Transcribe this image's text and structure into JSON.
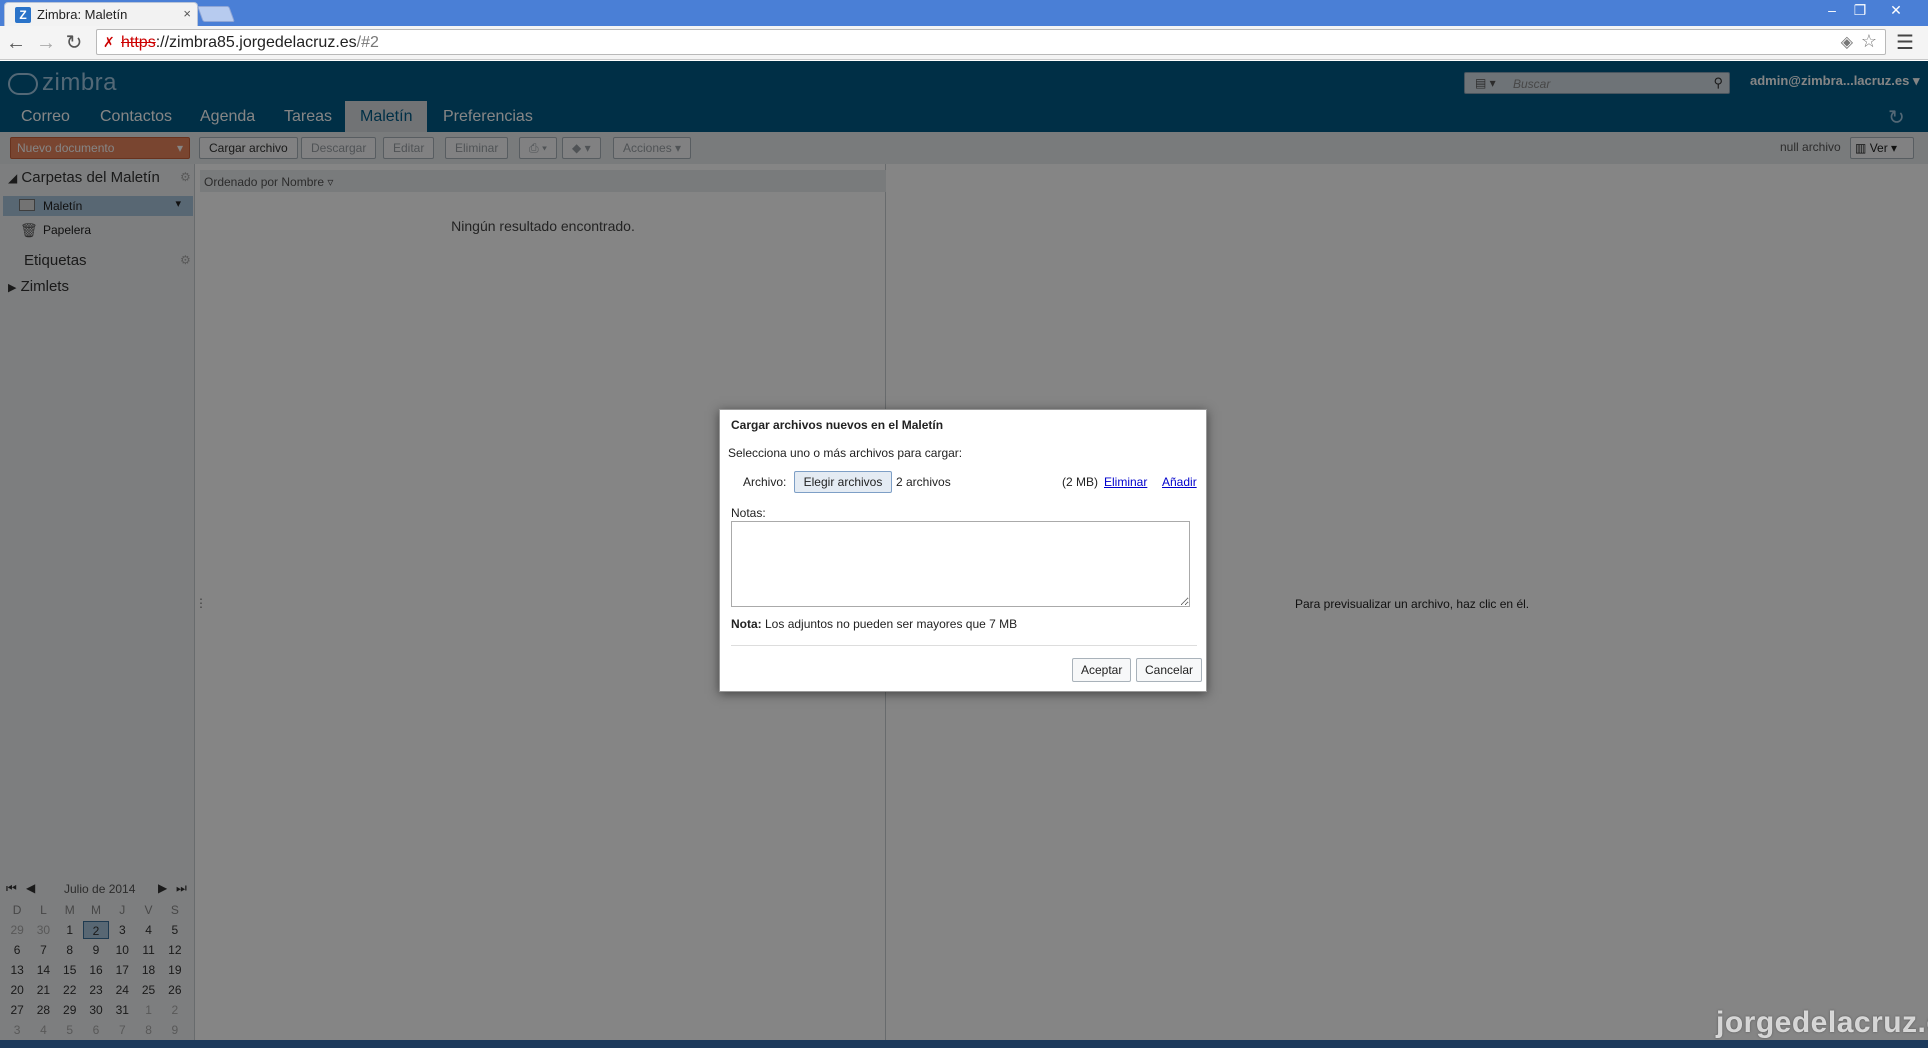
{
  "browser": {
    "tab_title": "Zimbra: Maletín",
    "url_protocol": "https",
    "url_host": "://zimbra85.jorgedelacruz.es",
    "url_path": "/#2"
  },
  "header": {
    "logo": "zimbra",
    "search_placeholder": "Buscar",
    "user": "admin@zimbra...lacruz.es",
    "tabs": [
      "Correo",
      "Contactos",
      "Agenda",
      "Tareas",
      "Maletín",
      "Preferencias"
    ],
    "active_tab": "Maletín"
  },
  "toolbar": {
    "new_document": "Nuevo documento",
    "upload": "Cargar archivo",
    "download": "Descargar",
    "edit": "Editar",
    "delete": "Eliminar",
    "actions": "Acciones",
    "file_count": "null archivo",
    "view": "Ver"
  },
  "sidebar": {
    "folders_header": "Carpetas del Maletín",
    "maletin": "Maletín",
    "papelera": "Papelera",
    "tags_header": "Etiquetas",
    "zimlets_header": "Zimlets"
  },
  "calendar": {
    "month": "Julio de 2014",
    "day_headers": [
      "D",
      "L",
      "M",
      "M",
      "J",
      "V",
      "S"
    ],
    "weeks": [
      [
        "29",
        "30",
        "1",
        "2",
        "3",
        "4",
        "5"
      ],
      [
        "6",
        "7",
        "8",
        "9",
        "10",
        "11",
        "12"
      ],
      [
        "13",
        "14",
        "15",
        "16",
        "17",
        "18",
        "19"
      ],
      [
        "20",
        "21",
        "22",
        "23",
        "24",
        "25",
        "26"
      ],
      [
        "27",
        "28",
        "29",
        "30",
        "31",
        "1",
        "2"
      ],
      [
        "3",
        "4",
        "5",
        "6",
        "7",
        "8",
        "9"
      ]
    ],
    "today": "2"
  },
  "list": {
    "sort_label": "Ordenado por Nombre",
    "empty_message": "Ningún resultado encontrado."
  },
  "preview": {
    "hint": "Para previsualizar un archivo, haz clic en él."
  },
  "dialog": {
    "title": "Cargar archivos nuevos en el Maletín",
    "intro": "Selecciona uno o más archivos para cargar:",
    "file_label": "Archivo:",
    "choose_button": "Elegir archivos",
    "file_count": "2 archivos",
    "size": "(2 MB)",
    "remove_link": "Eliminar",
    "add_link": "Añadir",
    "notes_label": "Notas:",
    "note_bold": "Nota:",
    "note_text": " Los adjuntos no pueden ser mayores que 7 MB",
    "accept": "Aceptar",
    "cancel": "Cancelar"
  },
  "watermark": "jorgedelacruz.es"
}
